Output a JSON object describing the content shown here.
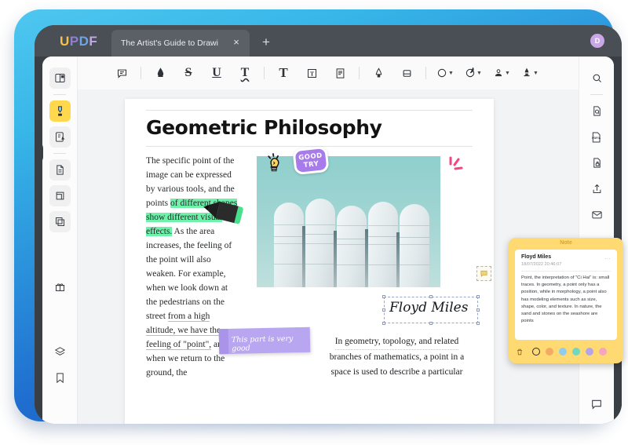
{
  "app": {
    "logo_letters": [
      {
        "ch": "U",
        "color": "#f5c242"
      },
      {
        "ch": "P",
        "color": "#8f7fd4"
      },
      {
        "ch": "D",
        "color": "#6aa6e8"
      },
      {
        "ch": "F",
        "color": "#c0a8e6"
      }
    ],
    "avatar_initial": "D"
  },
  "tabs": {
    "active_title": "The Artist's Guide to Drawi",
    "close_label": "×",
    "new_tab_label": "+"
  },
  "left_rail": {
    "items": [
      {
        "name": "reader-view",
        "icon": "book-open-icon",
        "active": false
      },
      {
        "name": "annotate-highlighter",
        "icon": "highlighter-icon",
        "active": true
      },
      {
        "name": "edit-pdf",
        "icon": "edit-document-icon",
        "active": false
      },
      {
        "name": "organize-pages",
        "icon": "page-icon",
        "active": false
      },
      {
        "name": "crop-page",
        "icon": "crop-icon",
        "active": false
      },
      {
        "name": "page-copy",
        "icon": "copy-pages-icon",
        "active": false
      },
      {
        "name": "gift-offer",
        "icon": "gift-icon",
        "active": false
      },
      {
        "name": "layers",
        "icon": "layers-icon",
        "active": false
      },
      {
        "name": "bookmarks",
        "icon": "bookmark-icon",
        "active": false
      }
    ]
  },
  "right_rail": {
    "items": [
      {
        "name": "search",
        "icon": "search-icon"
      },
      {
        "name": "ocr-recognize",
        "icon": "ocr-document-icon"
      },
      {
        "name": "convert-pdfa",
        "icon": "pdfa-icon"
      },
      {
        "name": "protect-document",
        "icon": "lock-document-icon"
      },
      {
        "name": "share",
        "icon": "share-upload-icon"
      },
      {
        "name": "mail",
        "icon": "envelope-icon"
      }
    ],
    "comment_button": {
      "name": "comment-panel",
      "icon": "comment-icon"
    }
  },
  "toolbar": {
    "items": [
      {
        "name": "add-note",
        "icon": "comment-box-icon",
        "label": "",
        "caret": false
      },
      {
        "sep": true
      },
      {
        "name": "highlight-text",
        "icon": "highlighter-tip-icon",
        "label": "",
        "caret": false
      },
      {
        "name": "strikethrough-text",
        "icon": "strikethrough-icon",
        "label": "S",
        "caret": false
      },
      {
        "name": "underline-text",
        "icon": "underline-icon",
        "label": "U",
        "caret": false
      },
      {
        "name": "squiggly-underline-text",
        "icon": "squiggly-icon",
        "label": "T",
        "caret": false
      },
      {
        "sep": true
      },
      {
        "name": "add-text",
        "icon": "text-icon",
        "label": "T",
        "caret": false
      },
      {
        "name": "text-box",
        "icon": "text-box-icon",
        "label": "T",
        "caret": false
      },
      {
        "name": "sticky-note",
        "icon": "note-lines-icon",
        "label": "",
        "caret": false
      },
      {
        "sep": true
      },
      {
        "name": "pencil-draw",
        "icon": "pen-icon",
        "label": "",
        "caret": false
      },
      {
        "name": "eraser",
        "icon": "eraser-icon",
        "label": "",
        "caret": false
      },
      {
        "sep": true
      },
      {
        "name": "shapes",
        "icon": "circle-shape-icon",
        "label": "",
        "caret": true
      },
      {
        "name": "shape-style",
        "icon": "half-circle-icon",
        "label": "",
        "caret": true
      },
      {
        "name": "stamp",
        "icon": "stamp-person-icon",
        "label": "",
        "caret": true
      },
      {
        "name": "signature",
        "icon": "signature-stamp-icon",
        "label": "",
        "caret": true
      }
    ]
  },
  "document": {
    "title": "Geometric Philosophy",
    "left_column": {
      "before_highlight": "The specific point of the image can be expressed by various tools, and the points ",
      "highlighted": "of different shapes show different visual effects.",
      "after_highlight_1": " As the area increases, the feeling of the point will also weaken. For example, when we look down at the pedestrians on the street ",
      "underlined": "from a high altitude, we have the feeling of \"point\",",
      "after_highlight_2": " and when we return to the ground, the"
    },
    "signature_text": "Floyd Miles",
    "right_column_line1": "In geometry, topology, and related",
    "right_column_line2": "branches of mathematics, a point in a",
    "right_column_line3": "space is used to describe a particular",
    "purple_sticker_text": "This part is very good",
    "good_try_sticker": {
      "line1": "GOOD",
      "line2": "TRY"
    }
  },
  "note_popup": {
    "header": "Note",
    "author": "Floyd Miles",
    "date": "18/07/2022 20:46:07",
    "more_label": "⋯",
    "body": "Point, the interpretation of \"Ci Hai\" is: small traces. In geometry, a point only has a position, while in morphology, a point also has modeling elements such as size, shape, color, and texture. In nature, the sand and stones on the seashore are points",
    "delete_icon": "trash-icon",
    "colors": [
      {
        "name": "selected-current",
        "hex": "transparent",
        "selected": true
      },
      {
        "name": "orange",
        "hex": "#f5aa64",
        "selected": false
      },
      {
        "name": "blue",
        "hex": "#8fcdee",
        "selected": false
      },
      {
        "name": "teal",
        "hex": "#6fd8be",
        "selected": false
      },
      {
        "name": "purple",
        "hex": "#b6a4ea",
        "selected": false
      },
      {
        "name": "pink",
        "hex": "#f4a6c0",
        "selected": false
      }
    ]
  }
}
